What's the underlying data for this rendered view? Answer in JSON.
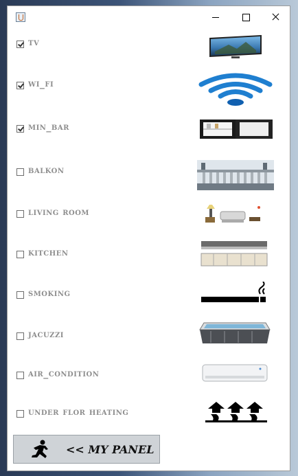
{
  "window": {
    "controls": {
      "minimize": "minimize-icon",
      "maximize": "maximize-icon",
      "close": "close-icon"
    }
  },
  "amenities": [
    {
      "label": "TV",
      "checked": true
    },
    {
      "label": "WI_FI",
      "checked": true
    },
    {
      "label": "MIN_BAR",
      "checked": true
    },
    {
      "label": "BALKON",
      "checked": false
    },
    {
      "label": "LIVING ROOM",
      "checked": false
    },
    {
      "label": "KITCHEN",
      "checked": false
    },
    {
      "label": "SMOKING",
      "checked": false
    },
    {
      "label": "JACUZZI",
      "checked": false
    },
    {
      "label": "AIR_CONDITION",
      "checked": false
    },
    {
      "label": "UNDER FLOR HEATING",
      "checked": false
    }
  ],
  "panel_button": {
    "label": "<< MY PANEL"
  },
  "colors": {
    "label_text": "#8e8e8e",
    "button_bg": "#cfd3d7"
  }
}
